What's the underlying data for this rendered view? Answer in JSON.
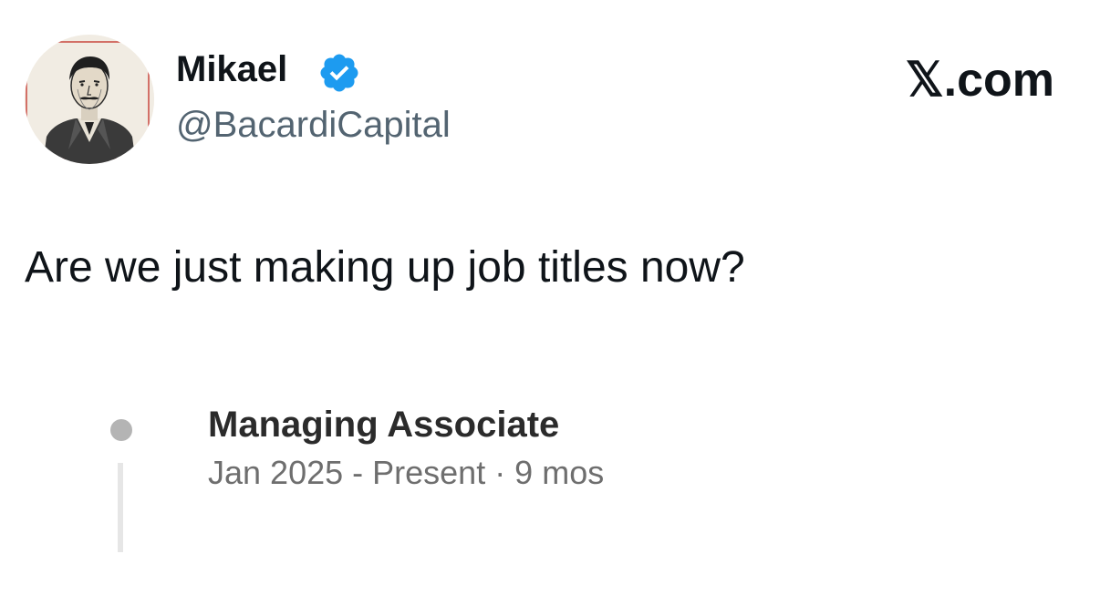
{
  "author": {
    "display_name": "Mikael",
    "handle": "@BacardiCapital",
    "verified": true,
    "avatar_icon": "portrait-avatar"
  },
  "site_brand": "𝕏.com",
  "tweet": {
    "text": "Are we just making up job titles now?"
  },
  "experience": {
    "title": "Managing Associate",
    "dates": "Jan 2025 - Present · 9 mos"
  },
  "colors": {
    "verified_badge": "#1d9bf0",
    "handle": "#536471",
    "text": "#0f1419",
    "timeline_dot": "#b4b4b4",
    "timeline_line": "#e6e6e6",
    "secondary_text": "#6e6e6e"
  }
}
